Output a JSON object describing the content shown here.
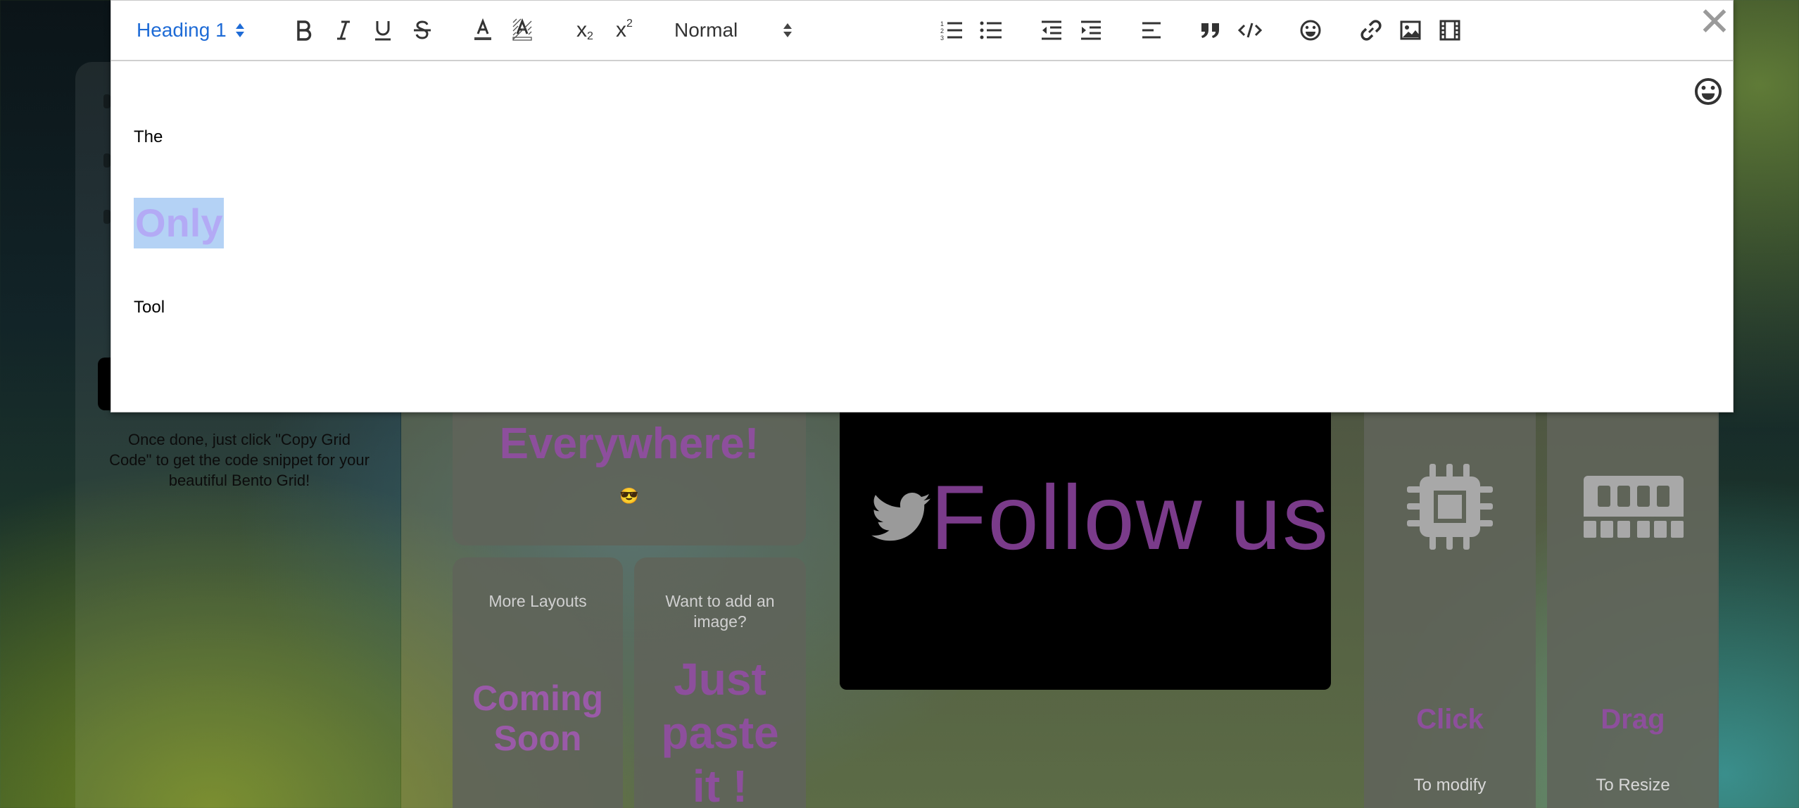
{
  "editor": {
    "toolbar": {
      "heading_picker": "Heading 1",
      "size_picker": "Normal",
      "buttons": [
        "bold",
        "italic",
        "underline",
        "strike",
        "color",
        "background",
        "subscript",
        "superscript",
        "ordered-list",
        "bullet-list",
        "indent-decrease",
        "indent-increase",
        "align",
        "blockquote",
        "code-block",
        "emoji",
        "link",
        "image",
        "video"
      ],
      "subscript_label": "x",
      "subscript_index": "2",
      "superscript_label": "x",
      "superscript_index": "2"
    },
    "close_label": "✕",
    "content": {
      "line1": "The",
      "line2": "Only",
      "line3": "Tool"
    },
    "highlight_color": "#b4d2f5"
  },
  "background": {
    "instructions": "Once done, just click \"Copy Grid Code\" to get the code snippet for your beautiful Bento Grid!",
    "tiles": {
      "everywhere": {
        "big": "Everywhere!",
        "emoji": "😎"
      },
      "more_layouts": {
        "label": "More Layouts",
        "big_line1": "Coming",
        "big_line2": "Soon"
      },
      "add_image": {
        "label": "Want to add an image?",
        "big_line1": "Just",
        "big_line2": "paste",
        "big_line3": "it !"
      },
      "follow": {
        "text": "Follow us",
        "icon": "twitter-icon"
      },
      "click": {
        "big": "Click",
        "sub": "To modify",
        "icon": "cpu-icon"
      },
      "drag": {
        "big": "Drag",
        "sub": "To Resize",
        "icon": "memory-icon"
      }
    }
  },
  "colors": {
    "accent_blue": "#1e6bd6",
    "purple": "#8d4f9c"
  }
}
